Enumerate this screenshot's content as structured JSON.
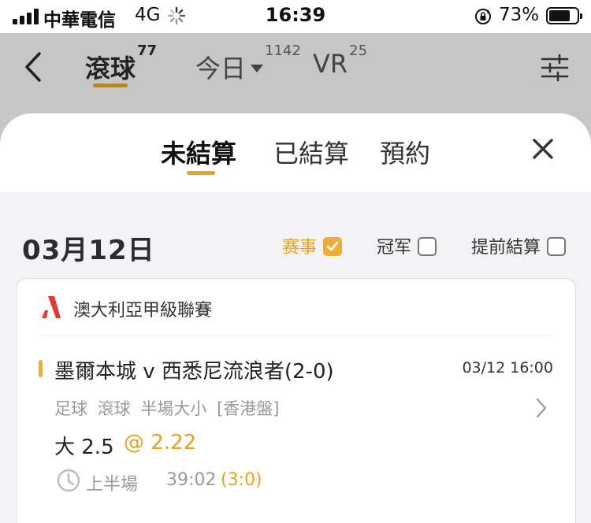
{
  "status_bar": {
    "carrier": "中華電信",
    "network": "4G",
    "time": "16:39",
    "battery_percent": "73%",
    "battery_level": 0.73
  },
  "nav": {
    "tabs": [
      {
        "label": "滾球",
        "count": "77",
        "active": true
      },
      {
        "label": "今日",
        "count": "1142",
        "active": false,
        "has_dropdown": true
      },
      {
        "label": "VR",
        "count": "25",
        "active": false
      }
    ]
  },
  "sheet": {
    "tabs": [
      {
        "label": "未結算",
        "active": true
      },
      {
        "label": "已結算",
        "active": false
      },
      {
        "label": "預約",
        "active": false
      }
    ]
  },
  "date_header": "03月12日",
  "filters": [
    {
      "label": "赛事",
      "checked": true
    },
    {
      "label": "冠军",
      "checked": false
    },
    {
      "label": "提前結算",
      "checked": false
    }
  ],
  "bet": {
    "league": "澳大利亞甲級聯賽",
    "match": "墨爾本城 v 西悉尼流浪者(2-0)",
    "match_time": "03/12 16:00",
    "sport": "足球",
    "bet_type": "滾球",
    "market": "半場大小",
    "odds_format": "[香港盤]",
    "selection": "大 2.5",
    "odds": "@ 2.22",
    "period": "上半場",
    "elapsed": "39:02",
    "score_at_bet": "(3:0)"
  },
  "colors": {
    "accent": "#f0ad36",
    "underline": "#b5862a",
    "league_logo": "#e53935"
  }
}
